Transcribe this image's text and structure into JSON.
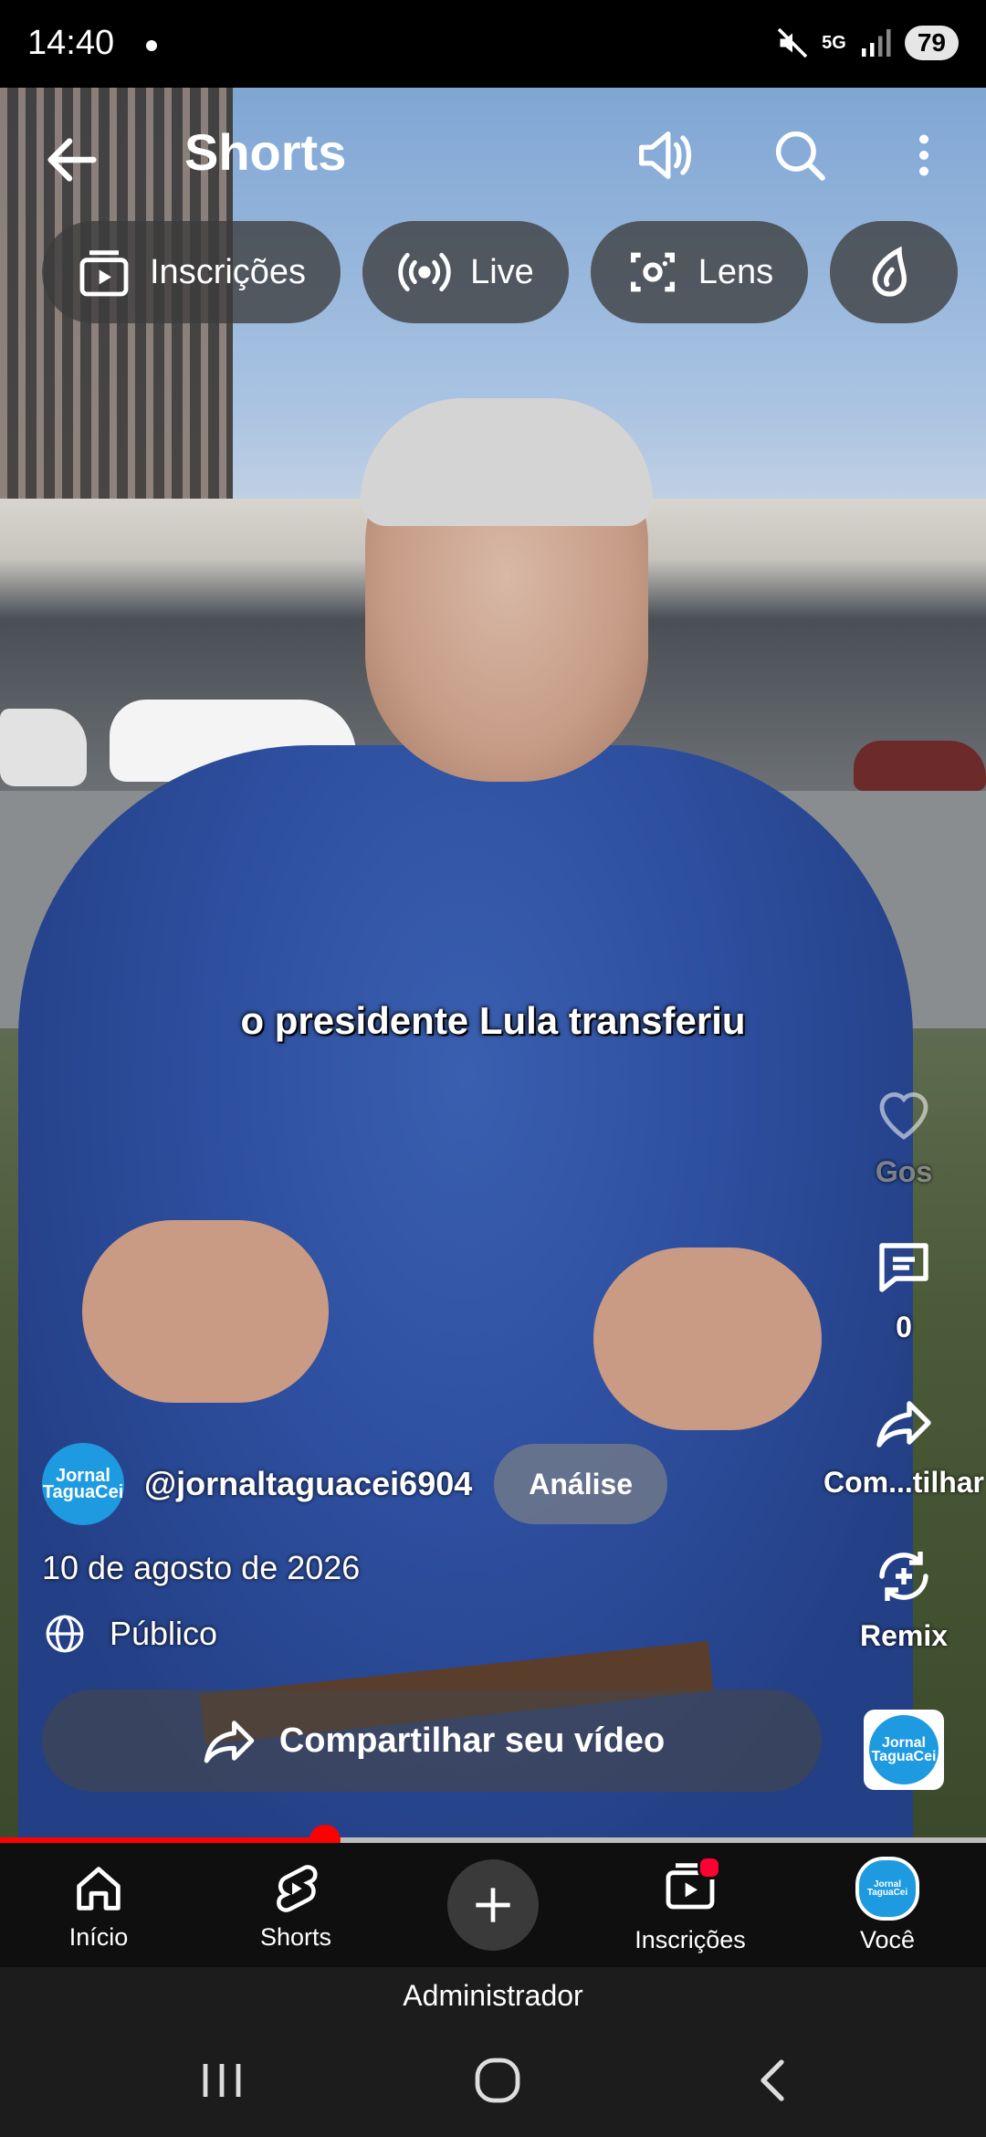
{
  "status_bar": {
    "time": "14:40",
    "network": "5G",
    "battery": "79"
  },
  "header": {
    "title": "Shorts"
  },
  "chips": [
    {
      "label": "Inscrições",
      "icon": "subscriptions-icon"
    },
    {
      "label": "Live",
      "icon": "live-broadcast-icon"
    },
    {
      "label": "Lens",
      "icon": "lens-camera-icon"
    },
    {
      "label": "",
      "icon": "drop-icon"
    }
  ],
  "video": {
    "caption": "o presidente Lula transferiu"
  },
  "actions": {
    "like_label": "Gos",
    "comments_count": "0",
    "share_label": "Com...tilhar",
    "remix_label": "Remix"
  },
  "channel": {
    "avatar_text_line1": "Jornal",
    "avatar_text_line2": "TaguaCei",
    "handle": "@jornaltaguacei6904",
    "analysis_button": "Análise",
    "date": "10 de agosto de 2026",
    "visibility": "Público"
  },
  "share_video_label": "Compartilhar seu vídeo",
  "progress": {
    "fraction": 0.33
  },
  "bottom_nav": [
    {
      "label": "Início",
      "icon": "home-icon"
    },
    {
      "label": "Shorts",
      "icon": "shorts-icon"
    },
    {
      "label": "",
      "icon": "create-plus-icon"
    },
    {
      "label": "Inscrições",
      "icon": "subscriptions-icon"
    },
    {
      "label": "Você",
      "icon": "profile-avatar"
    }
  ],
  "admin_label": "Administrador",
  "colors": {
    "accent": "#ff0000",
    "chip_bg": "#3c3c3c",
    "nav_bg": "#0f0f0f"
  }
}
